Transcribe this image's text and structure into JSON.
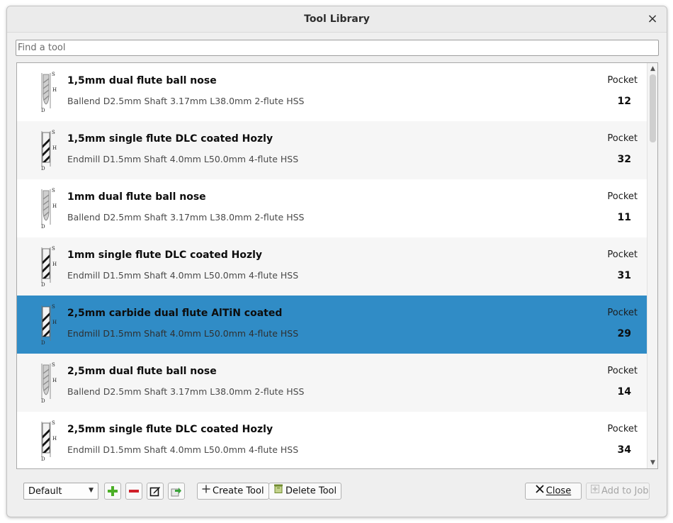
{
  "window": {
    "title": "Tool Library",
    "close_glyph": "×"
  },
  "search": {
    "placeholder": "Find a tool",
    "value": ""
  },
  "tools": [
    {
      "name": "1,5mm dual flute ball nose",
      "description": "Ballend D2.5mm Shaft 3.17mm L38.0mm 2-flute HSS",
      "pocket_label": "Pocket",
      "pocket": "12",
      "icon": "ballend-tool-icon"
    },
    {
      "name": "1,5mm single flute DLC coated Hozly",
      "description": "Endmill D1.5mm Shaft 4.0mm L50.0mm 4-flute HSS",
      "pocket_label": "Pocket",
      "pocket": "32",
      "icon": "endmill-tool-icon"
    },
    {
      "name": "1mm dual flute ball nose",
      "description": "Ballend D2.5mm Shaft 3.17mm L38.0mm 2-flute HSS",
      "pocket_label": "Pocket",
      "pocket": "11",
      "icon": "ballend-tool-icon"
    },
    {
      "name": "1mm single flute DLC coated Hozly",
      "description": "Endmill D1.5mm Shaft 4.0mm L50.0mm 4-flute HSS",
      "pocket_label": "Pocket",
      "pocket": "31",
      "icon": "endmill-tool-icon"
    },
    {
      "name": "2,5mm carbide dual flute AlTiN coated",
      "description": "Endmill D1.5mm Shaft 4.0mm L50.0mm 4-flute HSS",
      "pocket_label": "Pocket",
      "pocket": "29",
      "icon": "endmill-tool-icon",
      "selected": true
    },
    {
      "name": "2,5mm dual flute ball nose",
      "description": "Ballend D2.5mm Shaft 3.17mm L38.0mm 2-flute HSS",
      "pocket_label": "Pocket",
      "pocket": "14",
      "icon": "ballend-tool-icon"
    },
    {
      "name": "2,5mm single flute DLC coated Hozly",
      "description": "Endmill D1.5mm Shaft 4.0mm L50.0mm 4-flute HSS",
      "pocket_label": "Pocket",
      "pocket": "34",
      "icon": "endmill-tool-icon"
    }
  ],
  "toolbar": {
    "library_selected": "Default",
    "create_tool_label": "Create Tool",
    "delete_tool_label": "Delete Tool",
    "close_label": "Close",
    "add_to_job_label": "Add to Job",
    "icons": [
      "add-library-icon",
      "remove-library-icon",
      "rename-library-icon",
      "export-library-icon"
    ]
  },
  "colors": {
    "selected_row": "#308cc6",
    "add_green": "#4caf27",
    "remove_red": "#d0202a"
  }
}
